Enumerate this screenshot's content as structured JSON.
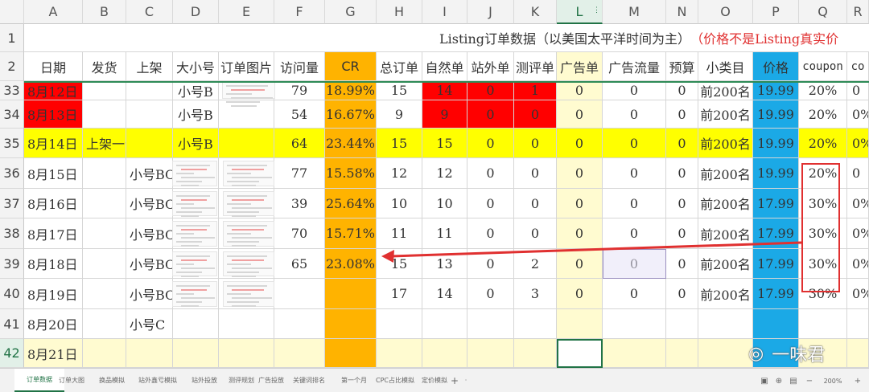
{
  "columns": [
    "A",
    "B",
    "C",
    "D",
    "E",
    "F",
    "G",
    "H",
    "I",
    "J",
    "K",
    "L",
    "M",
    "N",
    "O",
    "P",
    "Q",
    "R"
  ],
  "selected_column": "L",
  "title_row": {
    "number": "1",
    "text_black": "Listing订单数据（以美国太平洋时间为主）",
    "text_red": "（价格不是Listing真实价"
  },
  "header_row": {
    "number": "2",
    "labels": [
      "日期",
      "发货",
      "上架",
      "大小号",
      "订单图片",
      "访问量",
      "CR",
      "总订单",
      "自然单",
      "站外单",
      "测评单",
      "广告单",
      "广告流量",
      "预算",
      "小类目",
      "价格",
      "coupon",
      "co"
    ]
  },
  "rows": [
    {
      "num": "33",
      "cells": [
        "8月12日",
        "",
        "",
        "小号B",
        "",
        "79",
        "18.99%",
        "15",
        "14",
        "0",
        "1",
        "0",
        "0",
        "0",
        "前200名",
        "19.99",
        "20%",
        "0"
      ]
    },
    {
      "num": "34",
      "cells": [
        "8月13日",
        "",
        "",
        "小号B",
        "",
        "54",
        "16.67%",
        "9",
        "9",
        "0",
        "0",
        "0",
        "0",
        "0",
        "前200名",
        "19.99",
        "20%",
        "0%"
      ]
    },
    {
      "num": "35",
      "cells": [
        "8月14日",
        "上架一个月",
        "",
        "小号B",
        "",
        "64",
        "23.44%",
        "15",
        "15",
        "0",
        "0",
        "0",
        "0",
        "0",
        "前200名",
        "19.99",
        "20%",
        "0%"
      ]
    },
    {
      "num": "36",
      "cells": [
        "8月15日",
        "",
        "小号BC",
        "",
        "",
        "77",
        "15.58%",
        "12",
        "12",
        "0",
        "0",
        "0",
        "0",
        "0",
        "前200名",
        "19.99",
        "20%",
        "0"
      ]
    },
    {
      "num": "37",
      "cells": [
        "8月16日",
        "",
        "小号BC",
        "",
        "",
        "39",
        "25.64%",
        "10",
        "10",
        "0",
        "0",
        "0",
        "0",
        "0",
        "前200名",
        "17.99",
        "30%",
        "0%"
      ]
    },
    {
      "num": "38",
      "cells": [
        "8月17日",
        "",
        "小号BC",
        "",
        "",
        "70",
        "15.71%",
        "11",
        "11",
        "0",
        "0",
        "0",
        "0",
        "0",
        "前200名",
        "17.99",
        "30%",
        "0%"
      ]
    },
    {
      "num": "39",
      "cells": [
        "8月18日",
        "",
        "小号BC",
        "",
        "",
        "65",
        "23.08%",
        "15",
        "13",
        "0",
        "2",
        "0",
        "0",
        "0",
        "前200名",
        "17.99",
        "30%",
        "0%"
      ]
    },
    {
      "num": "40",
      "cells": [
        "8月19日",
        "",
        "小号BC",
        "",
        "",
        "",
        "",
        "17",
        "14",
        "0",
        "3",
        "0",
        "0",
        "0",
        "前200名",
        "17.99",
        "30%",
        "0%"
      ]
    },
    {
      "num": "41",
      "cells": [
        "8月20日",
        "",
        "小号C",
        "",
        "",
        "",
        "",
        "",
        "",
        "",
        "",
        "",
        "",
        "",
        "",
        "",
        "",
        ""
      ]
    },
    {
      "num": "42",
      "cells": [
        "8月21日",
        "",
        "",
        "",
        "",
        "",
        "",
        "",
        "",
        "",
        "",
        "",
        "",
        "",
        "",
        "",
        "",
        ""
      ]
    }
  ],
  "colors": {
    "cr_orange": "#ffb300",
    "price_blue": "#1ba9e6",
    "ad_yellow_light": "#fffbd0",
    "row_yellow": "#ffff00",
    "red": "#ff0000",
    "selection_green": "#217346",
    "annotation_red": "#e03030"
  },
  "sheet_tabs": [
    "订单数据",
    "订单大图",
    "换品模拟",
    "站外鑫亏模拟",
    "站外投放",
    "测评规划",
    "广告投放",
    "关键词排名",
    "第一个月",
    "CPC占比模拟",
    "定价模拟"
  ],
  "active_tab": "订单数据",
  "add_sheet_label": "+",
  "tab_more_label": "·",
  "zoom_label": "200%",
  "zoom_minus": "−",
  "zoom_plus": "+",
  "watermark": "一味君"
}
